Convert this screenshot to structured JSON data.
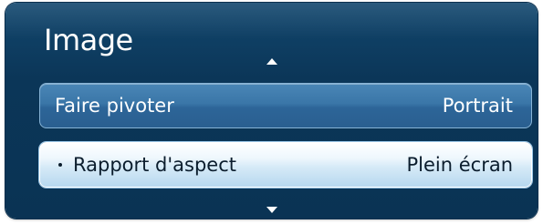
{
  "menu": {
    "title": "Image",
    "items": [
      {
        "label": "Faire pivoter",
        "value": "Portrait"
      },
      {
        "label": "Rapport d'aspect",
        "value": "Plein écran"
      }
    ]
  },
  "icons": {
    "scroll_up": "triangle-up-icon",
    "scroll_down": "triangle-down-icon",
    "selected_marker": "bullet-icon"
  },
  "colors": {
    "panel_background": "#0b3658",
    "item_background": "#3a76a8",
    "selected_item_background": "#d6eaf7",
    "text": "#ffffff",
    "selected_text": "#0b1d2d"
  }
}
